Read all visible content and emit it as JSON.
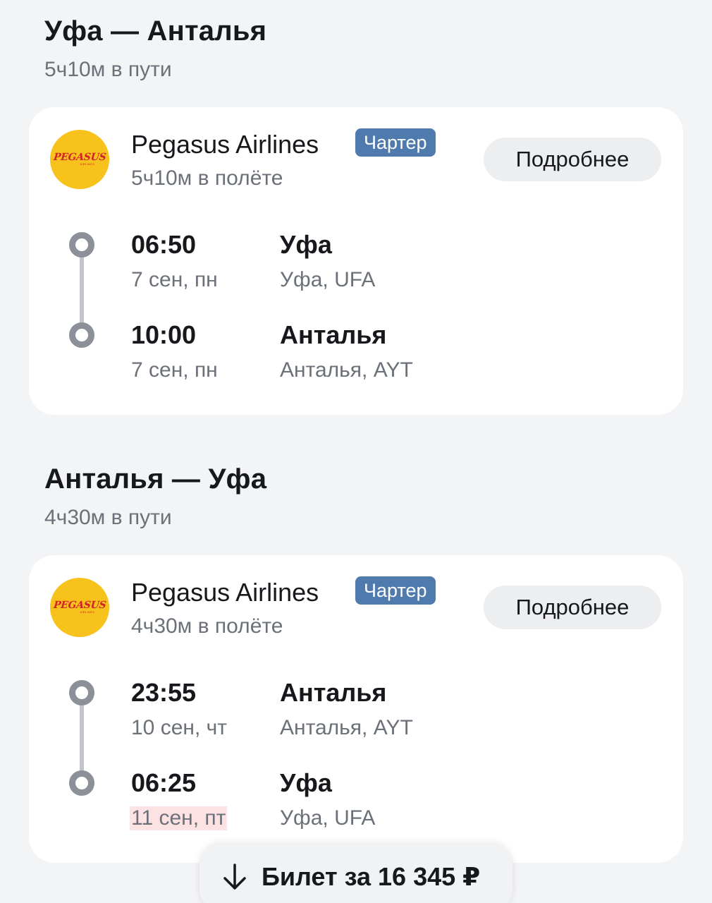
{
  "segments": [
    {
      "title": "Уфа — Анталья",
      "total_time": "5ч10м в пути",
      "airline": "Pegasus Airlines",
      "logo_text": "PEGASUS",
      "logo_subtext": "AIRLINES",
      "badge": "Чартер",
      "flight_time": "5ч10м в полёте",
      "details_label": "Подробнее",
      "departure": {
        "time": "06:50",
        "date": "7 сен, пн",
        "city": "Уфа",
        "airport": "Уфа, UFA"
      },
      "arrival": {
        "time": "10:00",
        "date": "7 сен, пн",
        "city": "Анталья",
        "airport": "Анталья, AYT"
      }
    },
    {
      "title": "Анталья — Уфа",
      "total_time": "4ч30м в пути",
      "airline": "Pegasus Airlines",
      "logo_text": "PEGASUS",
      "logo_subtext": "AIRLINES",
      "badge": "Чартер",
      "flight_time": "4ч30м в полёте",
      "details_label": "Подробнее",
      "departure": {
        "time": "23:55",
        "date": "10 сен, чт",
        "city": "Анталья",
        "airport": "Анталья, AYT"
      },
      "arrival": {
        "time": "06:25",
        "date": "11 сен, пт",
        "date_highlighted": true,
        "city": "Уфа",
        "airport": "Уфа, UFA"
      }
    }
  ],
  "ticket_button": {
    "label": "Билет за 16 345 ₽",
    "icon": "arrow-down-icon"
  },
  "colors": {
    "background": "#f3f4f6",
    "card": "#ffffff",
    "badge": "#4f7aae",
    "logo": "#f7c21b",
    "date_highlight": "#fde2e4"
  }
}
